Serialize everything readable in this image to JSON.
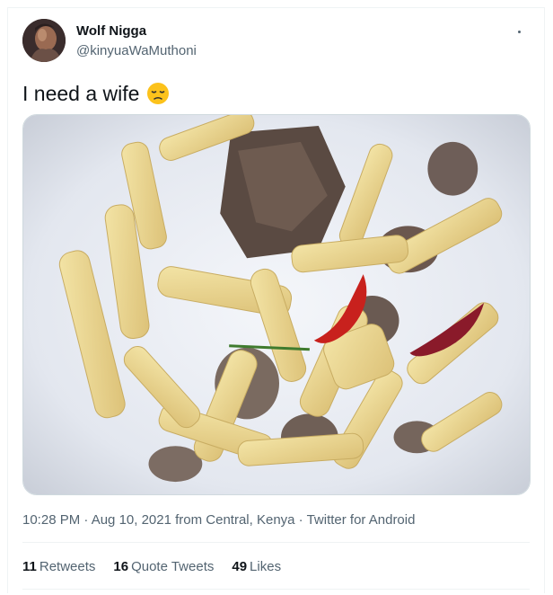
{
  "author": {
    "display_name": "Wolf Nigga",
    "handle": "@kinyuaWaMuthoni"
  },
  "more_icon": "more-horizontal-icon",
  "tweet": {
    "text": "I need a wife",
    "emoji": "disappointed-face-emoji"
  },
  "media": {
    "description_icon": "photo"
  },
  "meta": {
    "timestamp": "10:28 PM · Aug 10, 2021 from Central, Kenya · Twitter for Android"
  },
  "stats": {
    "retweets_count": "11",
    "retweets_label": "Retweets",
    "quote_count": "16",
    "quote_label": "Quote Tweets",
    "likes_count": "49",
    "likes_label": "Likes"
  },
  "colors": {
    "text_primary": "#0f1419",
    "text_secondary": "#536471",
    "border": "#eff3f4"
  }
}
